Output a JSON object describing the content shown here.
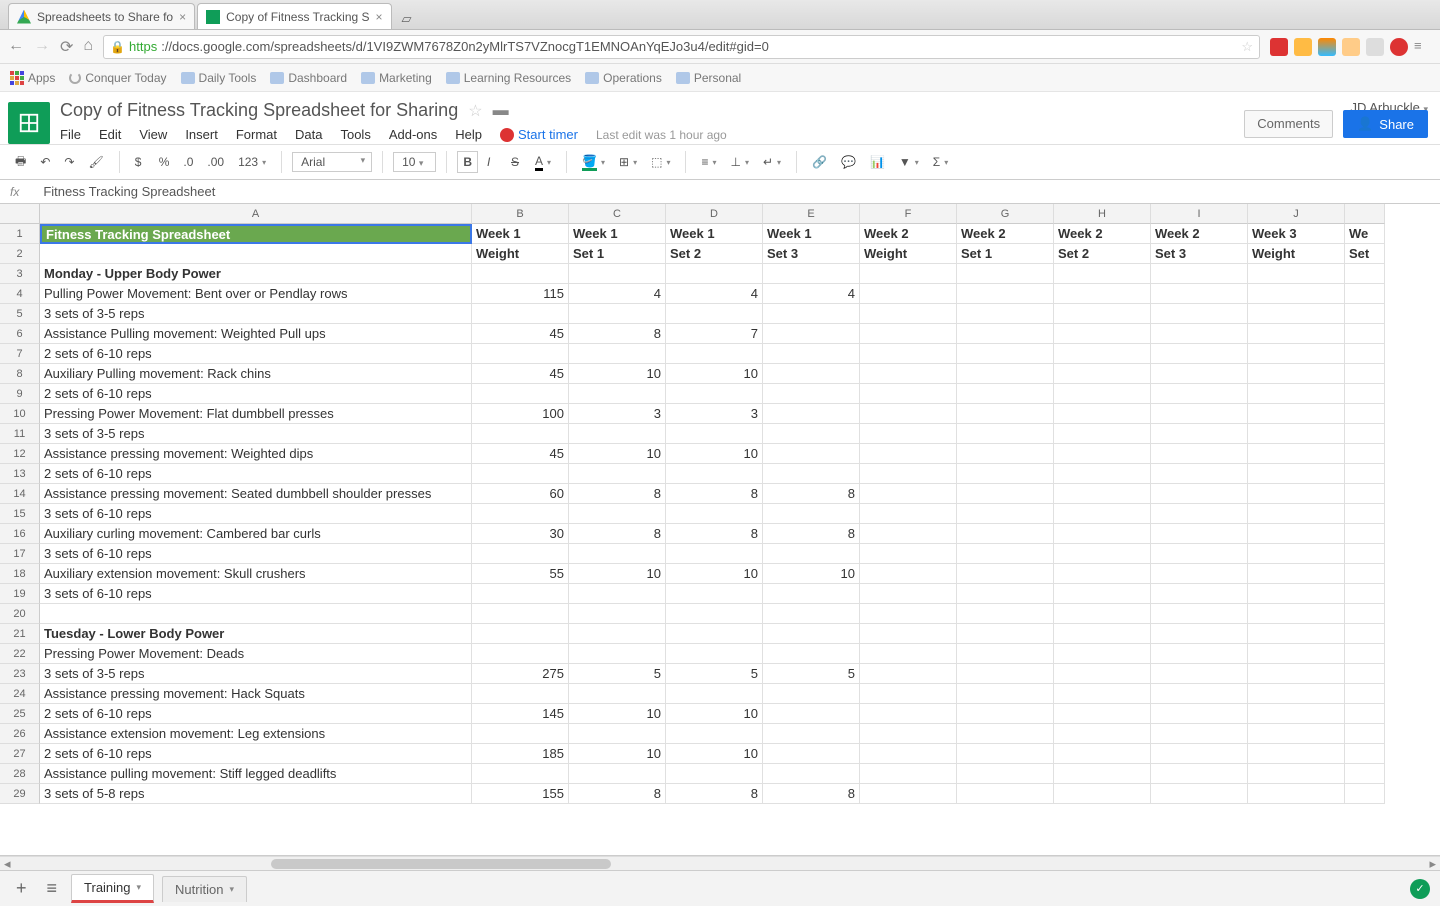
{
  "browser": {
    "tabs": [
      {
        "title": "Spreadsheets to Share fo"
      },
      {
        "title": "Copy of Fitness Tracking S"
      }
    ],
    "url_https": "https",
    "url_rest": "://docs.google.com/spreadsheets/d/1VI9ZWM7678Z0n2yMlrTS7VZnocgT1EMNOAnYqEJo3u4/edit#gid=0",
    "bookmarks": [
      "Apps",
      "Conquer Today",
      "Daily Tools",
      "Dashboard",
      "Marketing",
      "Learning Resources",
      "Operations",
      "Personal"
    ]
  },
  "header": {
    "doc_title": "Copy of Fitness Tracking Spreadsheet for Sharing",
    "menus": [
      "File",
      "Edit",
      "View",
      "Insert",
      "Format",
      "Data",
      "Tools",
      "Add-ons",
      "Help"
    ],
    "start_timer": "Start timer",
    "last_edit": "Last edit was 1 hour ago",
    "user": "JD Arbuckle",
    "comments": "Comments",
    "share": "Share"
  },
  "toolbar": {
    "font": "Arial",
    "size": "10",
    "format_items": [
      "$",
      "%",
      ".0",
      ".00",
      "123"
    ]
  },
  "formula": {
    "fx": "fx",
    "content": "Fitness Tracking Spreadsheet"
  },
  "columns": [
    "A",
    "B",
    "C",
    "D",
    "E",
    "F",
    "G",
    "H",
    "I",
    "J"
  ],
  "sheet": {
    "headers_row1": [
      "Fitness Tracking Spreadsheet",
      "Week 1",
      "Week 1",
      "Week 1",
      "Week 1",
      "Week 2",
      "Week 2",
      "Week 2",
      "Week 2",
      "Week 3",
      "We"
    ],
    "headers_row2": [
      "",
      "Weight",
      "Set 1",
      "Set 2",
      "Set 3",
      "Weight",
      "Set 1",
      "Set 2",
      "Set 3",
      "Weight",
      "Set"
    ],
    "rows": [
      {
        "n": 3,
        "a": "Monday - Upper Body Power",
        "bold": true,
        "vals": [
          "",
          "",
          "",
          "",
          "",
          "",
          "",
          "",
          "",
          ""
        ]
      },
      {
        "n": 4,
        "a": "Pulling Power Movement: Bent over or Pendlay rows",
        "vals": [
          "115",
          "4",
          "4",
          "4",
          "",
          "",
          "",
          "",
          "",
          ""
        ]
      },
      {
        "n": 5,
        "a": "3 sets of 3-5 reps",
        "vals": [
          "",
          "",
          "",
          "",
          "",
          "",
          "",
          "",
          "",
          ""
        ]
      },
      {
        "n": 6,
        "a": "Assistance Pulling movement: Weighted Pull ups",
        "vals": [
          "45",
          "8",
          "7",
          "",
          "",
          "",
          "",
          "",
          "",
          ""
        ]
      },
      {
        "n": 7,
        "a": "2 sets of 6-10 reps",
        "vals": [
          "",
          "",
          "",
          "",
          "",
          "",
          "",
          "",
          "",
          ""
        ]
      },
      {
        "n": 8,
        "a": "Auxiliary Pulling movement: Rack chins",
        "vals": [
          "45",
          "10",
          "10",
          "",
          "",
          "",
          "",
          "",
          "",
          ""
        ]
      },
      {
        "n": 9,
        "a": "2 sets of 6-10 reps",
        "vals": [
          "",
          "",
          "",
          "",
          "",
          "",
          "",
          "",
          "",
          ""
        ]
      },
      {
        "n": 10,
        "a": "Pressing Power Movement: Flat dumbbell presses",
        "vals": [
          "100",
          "3",
          "3",
          "",
          "",
          "",
          "",
          "",
          "",
          ""
        ]
      },
      {
        "n": 11,
        "a": "3 sets of 3-5 reps",
        "vals": [
          "",
          "",
          "",
          "",
          "",
          "",
          "",
          "",
          "",
          ""
        ]
      },
      {
        "n": 12,
        "a": "Assistance pressing movement: Weighted dips",
        "vals": [
          "45",
          "10",
          "10",
          "",
          "",
          "",
          "",
          "",
          "",
          ""
        ]
      },
      {
        "n": 13,
        "a": "2 sets of 6-10 reps",
        "vals": [
          "",
          "",
          "",
          "",
          "",
          "",
          "",
          "",
          "",
          ""
        ]
      },
      {
        "n": 14,
        "a": "Assistance pressing movement: Seated dumbbell shoulder presses",
        "vals": [
          "60",
          "8",
          "8",
          "8",
          "",
          "",
          "",
          "",
          "",
          ""
        ]
      },
      {
        "n": 15,
        "a": "3 sets of 6-10 reps",
        "vals": [
          "",
          "",
          "",
          "",
          "",
          "",
          "",
          "",
          "",
          ""
        ]
      },
      {
        "n": 16,
        "a": "Auxiliary curling movement: Cambered bar curls",
        "vals": [
          "30",
          "8",
          "8",
          "8",
          "",
          "",
          "",
          "",
          "",
          ""
        ]
      },
      {
        "n": 17,
        "a": "3 sets of 6-10 reps",
        "vals": [
          "",
          "",
          "",
          "",
          "",
          "",
          "",
          "",
          "",
          ""
        ]
      },
      {
        "n": 18,
        "a": "Auxiliary extension movement: Skull crushers",
        "vals": [
          "55",
          "10",
          "10",
          "10",
          "",
          "",
          "",
          "",
          "",
          ""
        ]
      },
      {
        "n": 19,
        "a": "3 sets of 6-10 reps",
        "vals": [
          "",
          "",
          "",
          "",
          "",
          "",
          "",
          "",
          "",
          ""
        ]
      },
      {
        "n": 20,
        "a": "",
        "vals": [
          "",
          "",
          "",
          "",
          "",
          "",
          "",
          "",
          "",
          ""
        ]
      },
      {
        "n": 21,
        "a": "Tuesday - Lower Body Power",
        "bold": true,
        "vals": [
          "",
          "",
          "",
          "",
          "",
          "",
          "",
          "",
          "",
          ""
        ]
      },
      {
        "n": 22,
        "a": "Pressing Power Movement: Deads",
        "vals": [
          "",
          "",
          "",
          "",
          "",
          "",
          "",
          "",
          "",
          ""
        ]
      },
      {
        "n": 23,
        "a": "3 sets of 3-5 reps",
        "vals": [
          "275",
          "5",
          "5",
          "5",
          "",
          "",
          "",
          "",
          "",
          ""
        ]
      },
      {
        "n": 24,
        "a": "Assistance pressing movement: Hack Squats",
        "vals": [
          "",
          "",
          "",
          "",
          "",
          "",
          "",
          "",
          "",
          ""
        ]
      },
      {
        "n": 25,
        "a": "2 sets of 6-10 reps",
        "vals": [
          "145",
          "10",
          "10",
          "",
          "",
          "",
          "",
          "",
          "",
          ""
        ]
      },
      {
        "n": 26,
        "a": "Assistance extension movement: Leg extensions",
        "vals": [
          "",
          "",
          "",
          "",
          "",
          "",
          "",
          "",
          "",
          ""
        ]
      },
      {
        "n": 27,
        "a": "2 sets of 6-10 reps",
        "vals": [
          "185",
          "10",
          "10",
          "",
          "",
          "",
          "",
          "",
          "",
          ""
        ]
      },
      {
        "n": 28,
        "a": "Assistance pulling movement: Stiff legged deadlifts",
        "vals": [
          "",
          "",
          "",
          "",
          "",
          "",
          "",
          "",
          "",
          ""
        ]
      },
      {
        "n": 29,
        "a": "3 sets of 5-8 reps",
        "vals": [
          "155",
          "8",
          "8",
          "8",
          "",
          "",
          "",
          "",
          "",
          ""
        ]
      }
    ]
  },
  "sheet_tabs": {
    "active": "Training",
    "other": "Nutrition"
  }
}
